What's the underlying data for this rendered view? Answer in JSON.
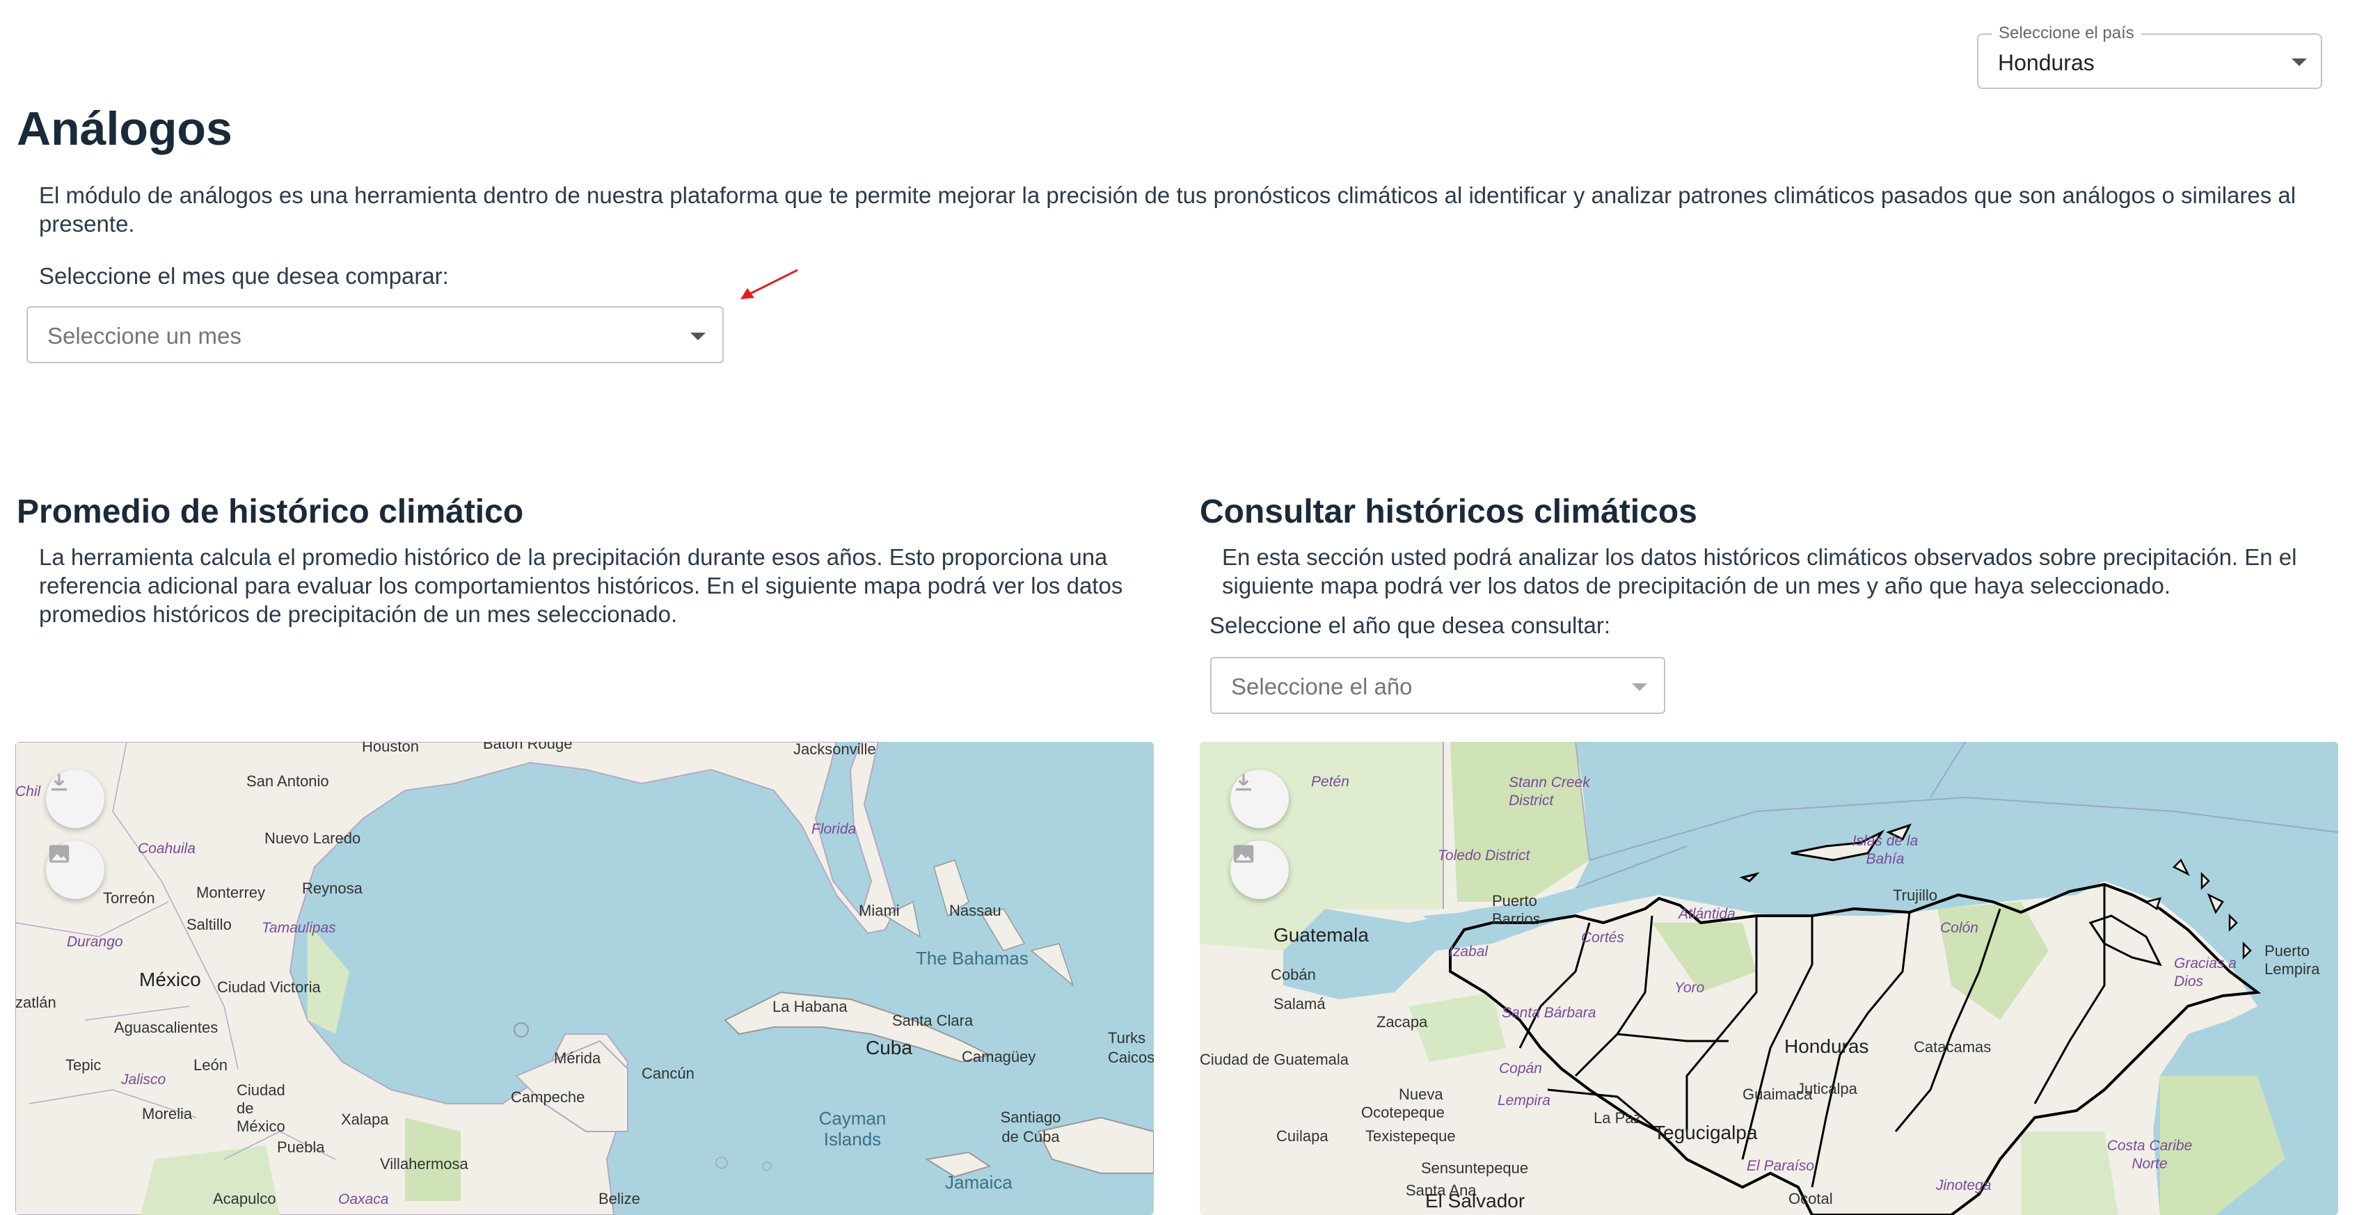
{
  "country": {
    "legend": "Seleccione el país",
    "value": "Honduras"
  },
  "header": {
    "title": "Análogos",
    "description": "El módulo de análogos es una herramienta dentro de nuestra plataforma que te permite mejorar la precisión de tus pronósticos climáticos al identificar y analizar patrones climáticos pasados que son análogos o similares al presente."
  },
  "month": {
    "label": "Seleccione el mes que desea comparar:",
    "placeholder": "Seleccione un mes"
  },
  "left_section": {
    "title": "Promedio de histórico climático",
    "description": "La herramienta calcula el promedio histórico de la precipitación durante esos años. Esto proporciona una referencia adicional para evaluar los comportamientos históricos. En el siguiente mapa podrá ver los datos promedios históricos de precipitación de un mes seleccionado."
  },
  "right_section": {
    "title": "Consultar históricos climáticos",
    "description": "En esta sección usted podrá analizar los datos históricos climáticos observados sobre precipitación. En el siguiente mapa podrá ver los datos de precipitación de un mes y año que haya seleccionado.",
    "year_label": "Seleccione el año que desea consultar:",
    "year_placeholder": "Seleccione el año"
  },
  "icons": {
    "download": "download-icon",
    "image": "image-icon",
    "dropdown": "chevron-down-icon",
    "annotation": "red-arrow-icon"
  },
  "colors": {
    "accent_arrow": "#e02020",
    "water": "#aad3df",
    "land": "#f2efe9",
    "border": "#000000"
  },
  "left_map_labels": [
    "Houston",
    "Baton Rouge",
    "Jacksonville",
    "San Antonio",
    "Florida",
    "Nuevo Laredo",
    "Coahuila",
    "Monterrey",
    "Reynosa",
    "Torreón",
    "Saltillo",
    "Tamaulipas",
    "Durango",
    "Miami",
    "Nassau",
    "The Bahamas",
    "México",
    "Ciudad Victoria",
    "Aguascalientes",
    "La Habana",
    "Santa Clara",
    "Cuba",
    "Camagüey",
    "Tepic",
    "León",
    "Jalisco",
    "Mérida",
    "Cancún",
    "Ciudad de México",
    "Morelia",
    "Xalapa",
    "Campeche",
    "Puebla",
    "Cayman Islands",
    "Santiago de Cuba",
    "Villahermosa",
    "Acapulco",
    "Oaxaca",
    "Belize",
    "Jamaica",
    "Turks Caicos",
    "Chil",
    "zatlán"
  ],
  "right_map_labels": [
    "Petén",
    "Stann Creek District",
    "Toledo District",
    "Islas de la Bahía",
    "Puerto Barrios",
    "Izabal",
    "Guatemala",
    "Cobán",
    "Salamá",
    "Zacapa",
    "Santa Bárbara",
    "Ciudad de Guatemala",
    "Cortés",
    "Atlántida",
    "Colón",
    "Yoro",
    "Honduras",
    "Catacamas",
    "Juticalpa",
    "Copán",
    "Ocotepeque",
    "Cuilapa",
    "Texistepeque",
    "Lempira",
    "La Paz",
    "Tegucigalpa",
    "Guaimaca",
    "Sensuntepeque",
    "Santa Ana",
    "El Salvador",
    "El Paraíso",
    "Jinotega",
    "Ocotal",
    "Costa Caribe Norte",
    "Puerto Lempira",
    "Gracias a Dios",
    "Trujillo",
    "Nueva"
  ]
}
